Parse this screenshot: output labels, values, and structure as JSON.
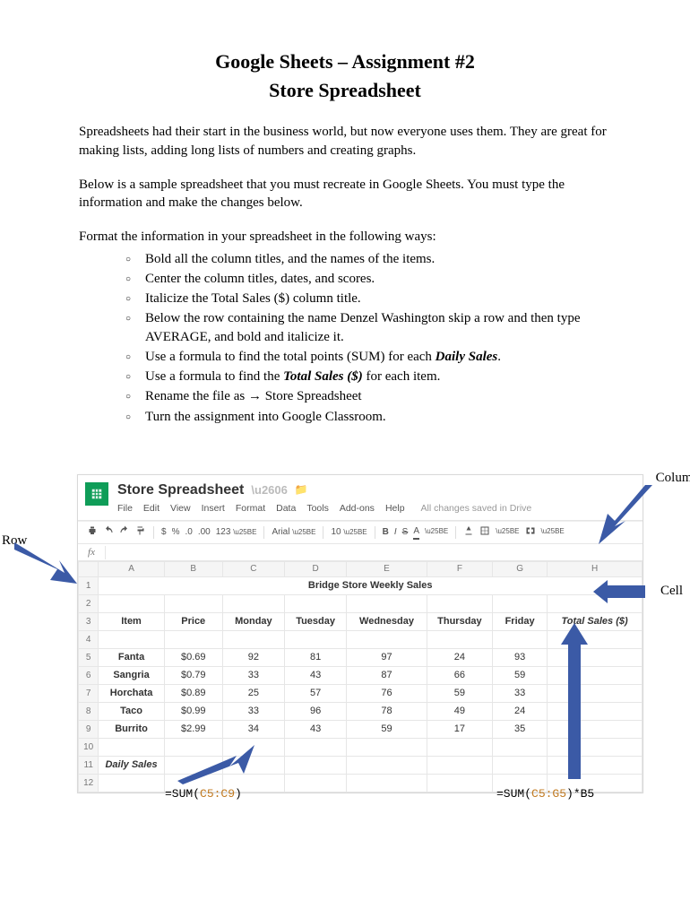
{
  "doc": {
    "title_line1": "Google Sheets – Assignment #2",
    "title_line2": "Store Spreadsheet",
    "para1": "Spreadsheets had their start in the business world, but now everyone uses them.  They are great for making lists, adding long lists of numbers and creating graphs.",
    "para2": "Below is a sample spreadsheet that you must recreate in Google Sheets.  You must type the information and make the changes below.",
    "para3": "Format the information in your spreadsheet in the following ways:",
    "instructions": {
      "i0": "Bold all the column titles, and the names of the items.",
      "i1": "Center the column titles, dates, and scores.",
      "i2": "Italicize the Total Sales ($) column title.",
      "i3a": "Below the row containing the name Denzel Washington skip a row and then type AVERAGE, and bold and italicize it.",
      "i4a": "Use a formula to find the total points (SUM) for each ",
      "i4b": "Daily Sales",
      "i4c": ".",
      "i5a": "Use a formula to find the ",
      "i5b": "Total Sales ($)",
      "i5c": " for each item.",
      "i6a": "Rename the file as ",
      "i6arrow": "→",
      "i6b": "  Store Spreadsheet",
      "i7": "Turn the assignment into Google Classroom."
    }
  },
  "sheet": {
    "doc_title": "Store Spreadsheet",
    "menus": {
      "file": "File",
      "edit": "Edit",
      "view": "View",
      "insert": "Insert",
      "format": "Format",
      "data": "Data",
      "tools": "Tools",
      "addons": "Add-ons",
      "help": "Help",
      "saved": "All changes saved in Drive"
    },
    "toolbar": {
      "dollar": "$",
      "percent": "%",
      "dec1": ".0",
      "dec2": ".00",
      "num": "123",
      "font": "Arial",
      "size": "10",
      "bold": "B",
      "italic": "I",
      "strike": "S",
      "underline": "A"
    },
    "fx": "fx",
    "cols": {
      "A": "A",
      "B": "B",
      "C": "C",
      "D": "D",
      "E": "E",
      "F": "F",
      "G": "G",
      "H": "H"
    },
    "rows": {
      "r1": "1",
      "r2": "2",
      "r3": "3",
      "r4": "4",
      "r5": "5",
      "r6": "6",
      "r7": "7",
      "r8": "8",
      "r9": "9",
      "r10": "10",
      "r11": "11",
      "r12": "12"
    },
    "title_cell": "Bridge Store Weekly Sales",
    "headers": {
      "item": "Item",
      "price": "Price",
      "mon": "Monday",
      "tue": "Tuesday",
      "wed": "Wednesday",
      "thu": "Thursday",
      "fri": "Friday",
      "total": "Total Sales ($)"
    },
    "data": {
      "r5": {
        "item": "Fanta",
        "price": "$0.69",
        "c": "92",
        "d": "81",
        "e": "97",
        "f": "24",
        "g": "93"
      },
      "r6": {
        "item": "Sangria",
        "price": "$0.79",
        "c": "33",
        "d": "43",
        "e": "87",
        "f": "66",
        "g": "59"
      },
      "r7": {
        "item": "Horchata",
        "price": "$0.89",
        "c": "25",
        "d": "57",
        "e": "76",
        "f": "59",
        "g": "33"
      },
      "r8": {
        "item": "Taco",
        "price": "$0.99",
        "c": "33",
        "d": "96",
        "e": "78",
        "f": "49",
        "g": "24"
      },
      "r9": {
        "item": "Burrito",
        "price": "$2.99",
        "c": "34",
        "d": "43",
        "e": "59",
        "f": "17",
        "g": "35"
      }
    },
    "daily_sales": "Daily Sales"
  },
  "labels": {
    "row": "Row",
    "column": "Column",
    "cell": "Cell"
  },
  "formulas": {
    "left_eq": "=SUM(",
    "left_ref": "C5:C9",
    "left_close": ")",
    "right_eq": "=SUM(",
    "right_ref": "C5:G5",
    "right_close": ")*B5"
  }
}
